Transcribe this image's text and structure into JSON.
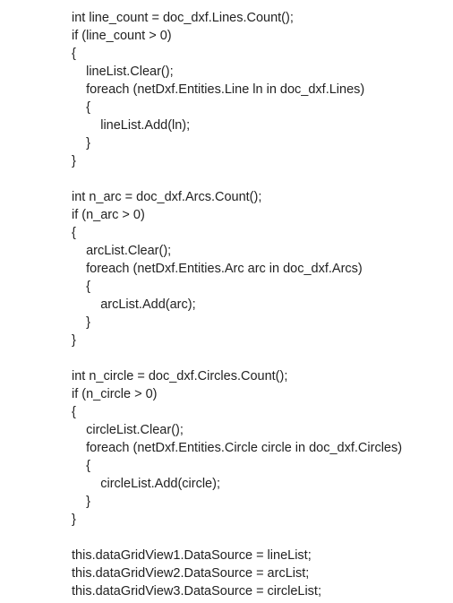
{
  "code_lines": [
    "int line_count = doc_dxf.Lines.Count();",
    "if (line_count > 0)",
    "{",
    "    lineList.Clear();",
    "    foreach (netDxf.Entities.Line ln in doc_dxf.Lines)",
    "    {",
    "        lineList.Add(ln);",
    "    }",
    "}",
    "",
    "int n_arc = doc_dxf.Arcs.Count();",
    "if (n_arc > 0)",
    "{",
    "    arcList.Clear();",
    "    foreach (netDxf.Entities.Arc arc in doc_dxf.Arcs)",
    "    {",
    "        arcList.Add(arc);",
    "    }",
    "}",
    "",
    "int n_circle = doc_dxf.Circles.Count();",
    "if (n_circle > 0)",
    "{",
    "    circleList.Clear();",
    "    foreach (netDxf.Entities.Circle circle in doc_dxf.Circles)",
    "    {",
    "        circleList.Add(circle);",
    "    }",
    "}",
    "",
    "this.dataGridView1.DataSource = lineList;",
    "this.dataGridView2.DataSource = arcList;",
    "this.dataGridView3.DataSource = circleList;"
  ]
}
